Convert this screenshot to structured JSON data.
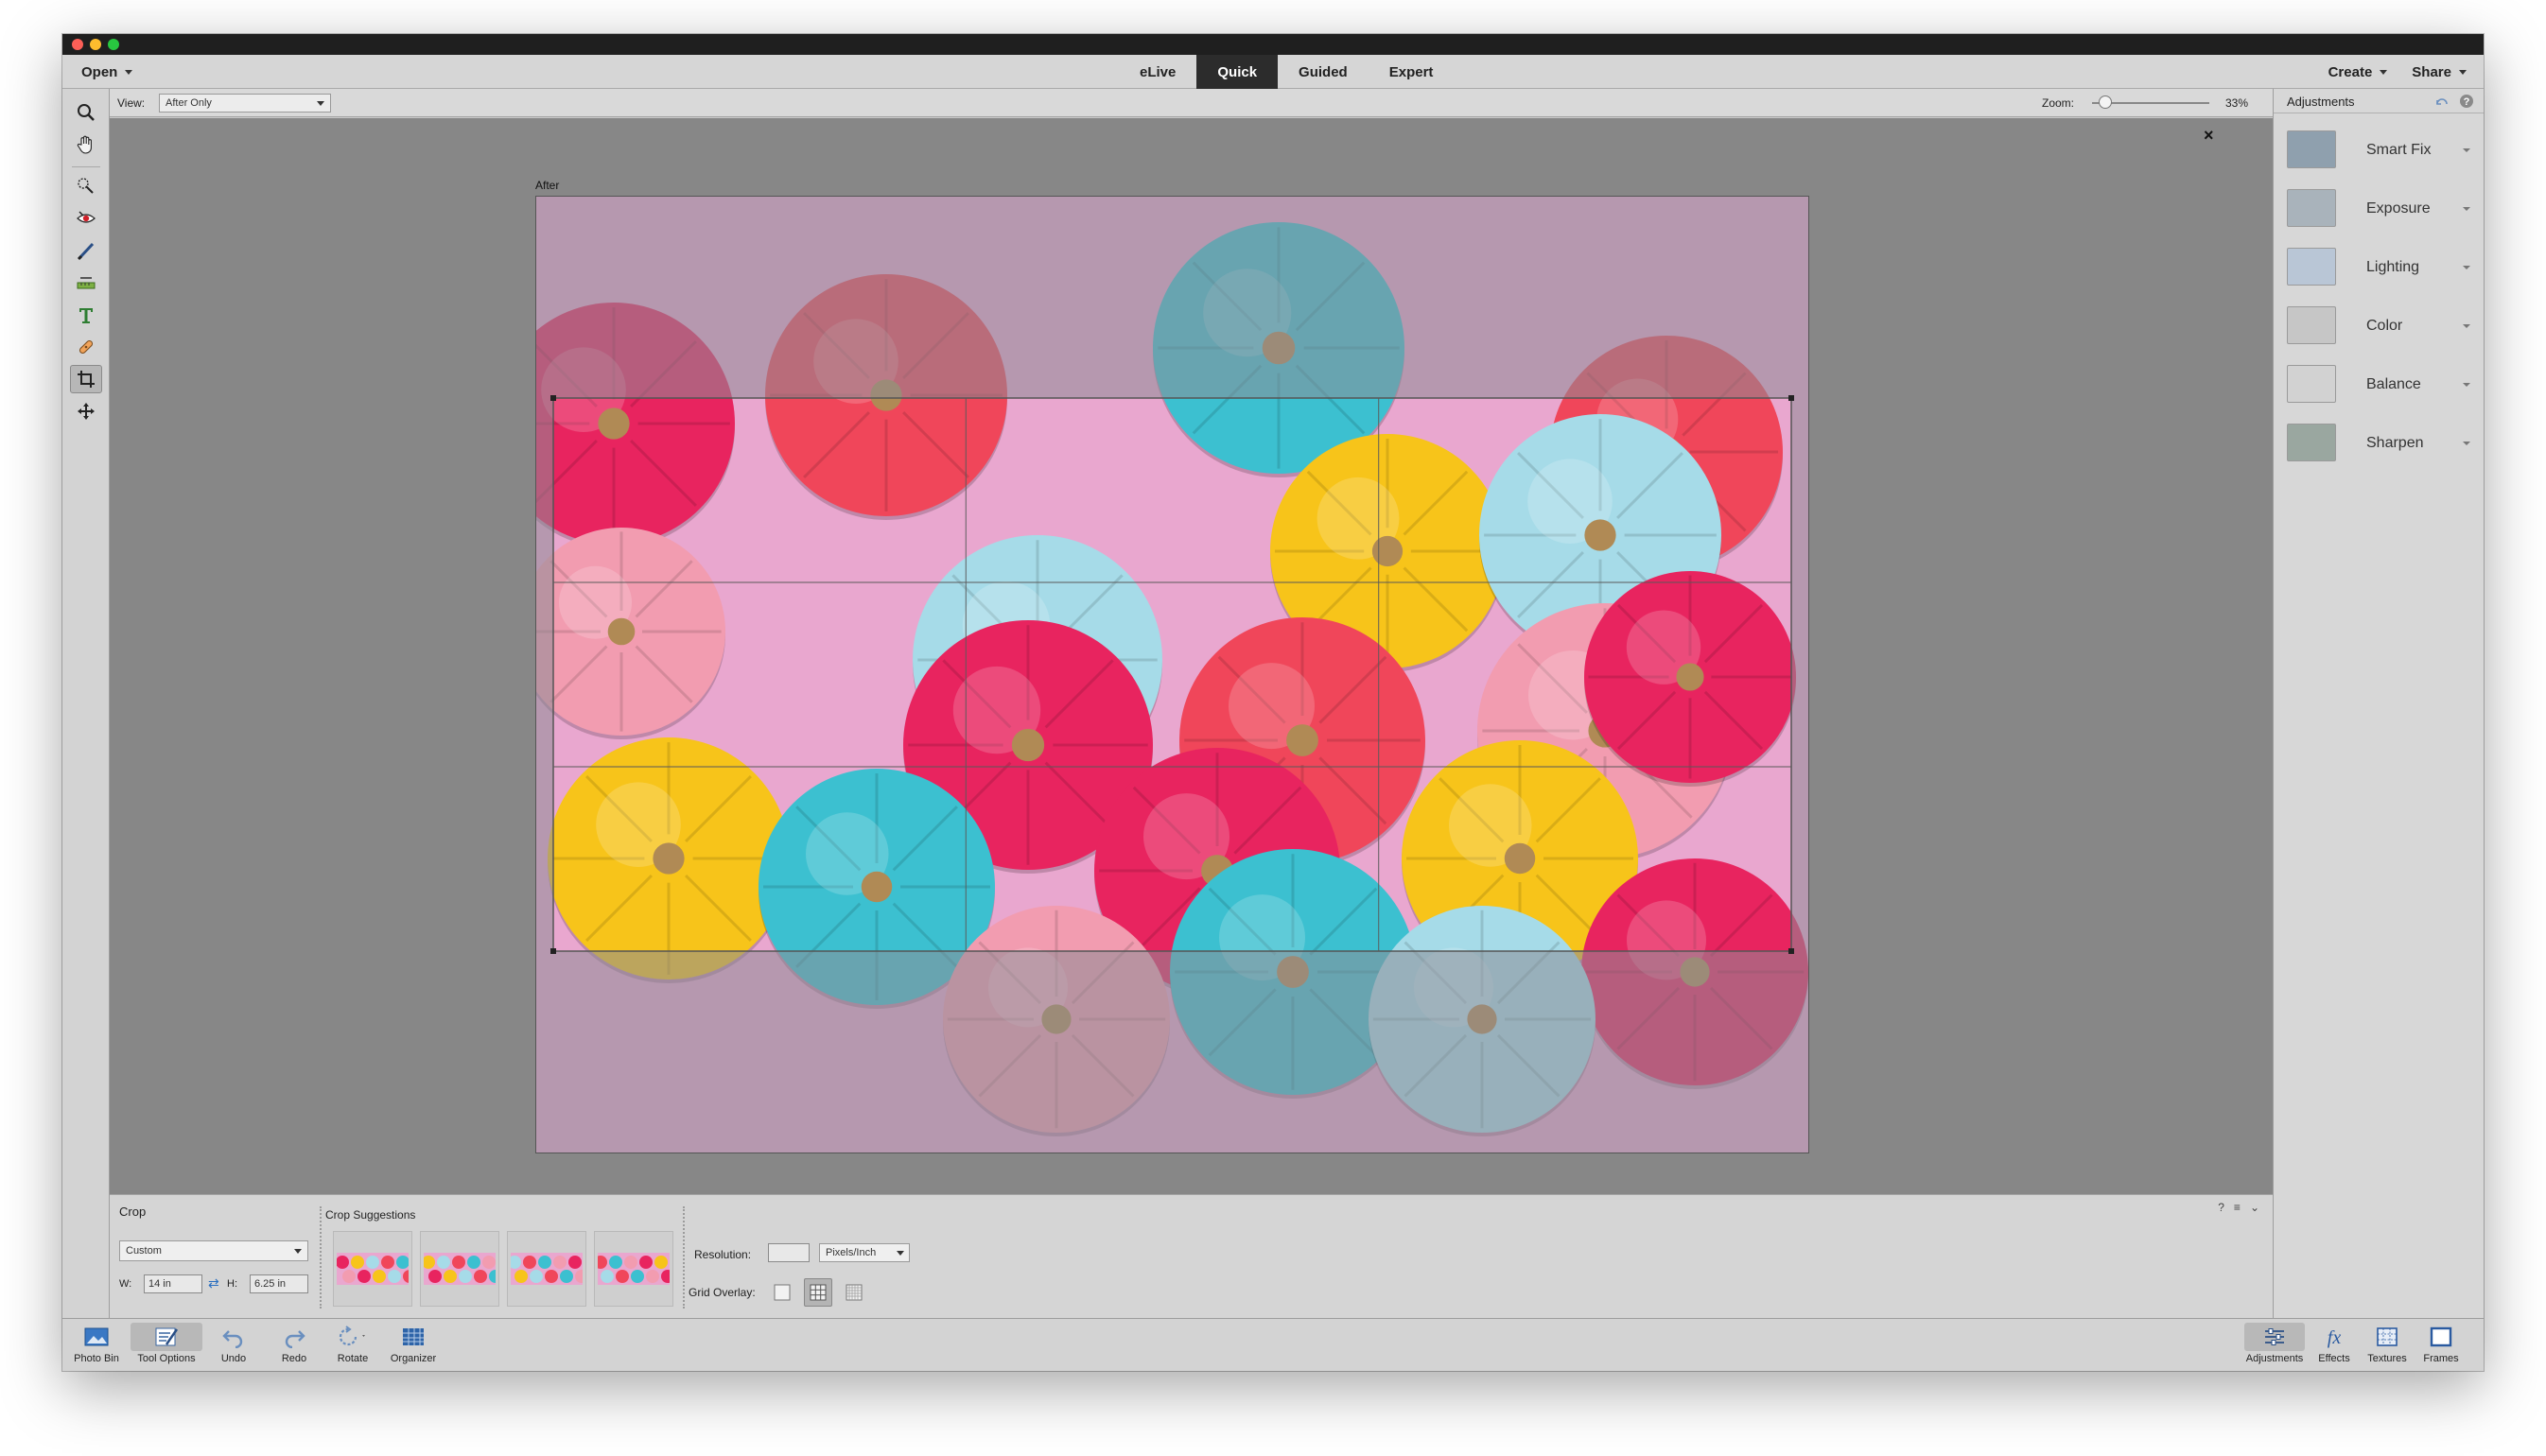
{
  "menubar": {
    "open_label": "Open",
    "modes": [
      "eLive",
      "Quick",
      "Guided",
      "Expert"
    ],
    "active_mode": "Quick",
    "create_label": "Create",
    "share_label": "Share"
  },
  "viewbar": {
    "view_label": "View:",
    "view_value": "After Only",
    "zoom_label": "Zoom:",
    "zoom_value": "33%",
    "zoom_level_fraction": 0.06
  },
  "toolbar": {
    "tools": [
      "zoom-tool",
      "hand-tool",
      "quick-selection-tool",
      "red-eye-tool",
      "whiten-teeth-tool",
      "straighten-tool",
      "type-tool",
      "spot-healing-tool",
      "crop-tool",
      "move-tool"
    ],
    "active_tool": "crop-tool"
  },
  "canvas": {
    "after_label": "After",
    "close_glyph": "×"
  },
  "adjustments": {
    "title": "Adjustments",
    "items": [
      {
        "label": "Smart Fix",
        "icon": "smart-fix-icon"
      },
      {
        "label": "Exposure",
        "icon": "exposure-icon"
      },
      {
        "label": "Lighting",
        "icon": "lighting-icon"
      },
      {
        "label": "Color",
        "icon": "color-icon"
      },
      {
        "label": "Balance",
        "icon": "balance-icon"
      },
      {
        "label": "Sharpen",
        "icon": "sharpen-icon"
      }
    ]
  },
  "tool_options": {
    "title": "Crop",
    "preset_value": "Custom",
    "w_label": "W:",
    "w_value": "14 in",
    "h_label": "H:",
    "h_value": "6.25 in",
    "suggestions_title": "Crop Suggestions",
    "resolution_label": "Resolution:",
    "resolution_value": "",
    "unit_value": "Pixels/Inch",
    "grid_overlay_label": "Grid Overlay:",
    "grid_overlay_selected": "rule-of-thirds"
  },
  "bottombar": {
    "left": [
      {
        "label": "Photo Bin",
        "icon": "photo-bin-icon"
      },
      {
        "label": "Tool Options",
        "icon": "tool-options-icon"
      },
      {
        "label": "Undo",
        "icon": "undo-icon"
      },
      {
        "label": "Redo",
        "icon": "redo-icon"
      },
      {
        "label": "Rotate",
        "icon": "rotate-icon"
      },
      {
        "label": "Organizer",
        "icon": "organizer-icon"
      }
    ],
    "right": [
      {
        "label": "Adjustments",
        "icon": "adjustments-icon"
      },
      {
        "label": "Effects",
        "icon": "effects-icon"
      },
      {
        "label": "Textures",
        "icon": "textures-icon"
      },
      {
        "label": "Frames",
        "icon": "frames-icon"
      }
    ]
  },
  "colors": {
    "pumpkin_pink": "#e8245f",
    "pumpkin_red": "#f0465a",
    "pumpkin_yellow": "#f7c41a",
    "pumpkin_lightblue": "#a6dbe8",
    "pumpkin_teal": "#3cc0d0",
    "pumpkin_lightpink": "#f29cb0",
    "background_pink": "#e9a7cf"
  }
}
